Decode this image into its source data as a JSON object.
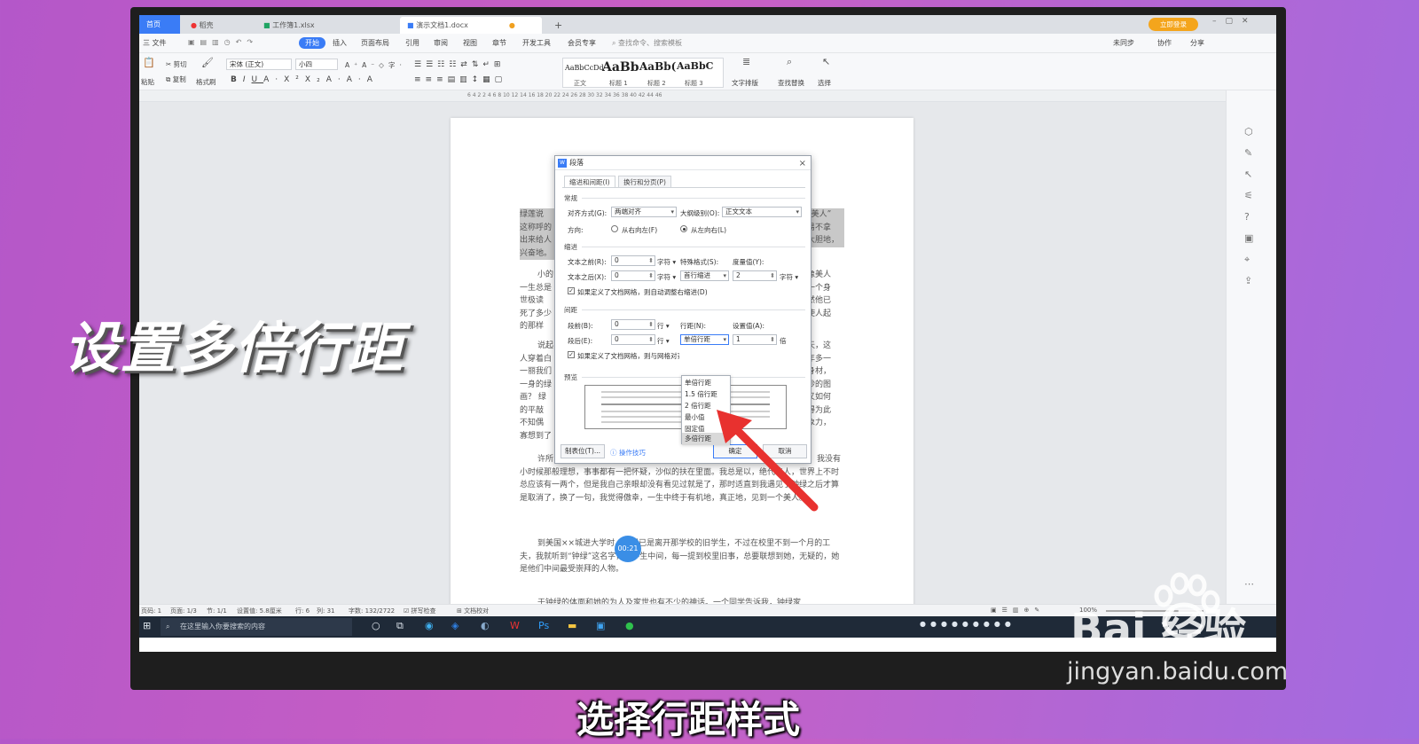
{
  "tabs": {
    "home": "首页",
    "t1": "稻壳",
    "t2": "工作簿1.xlsx",
    "t3": "演示文档1.docx",
    "new": "+"
  },
  "tabbar_right": {
    "login": "立即登录"
  },
  "menu": {
    "file": "三 文件",
    "start": "开始",
    "insert": "插入",
    "layout": "页面布局",
    "ref": "引用",
    "review": "审阅",
    "view": "视图",
    "chapter": "章节",
    "dev": "开发工具",
    "member": "会员专享",
    "search": "查找命令、搜索模板",
    "sync": "未同步",
    "collab": "协作",
    "share": "分享"
  },
  "ribbon": {
    "paste": "粘贴",
    "cut": "剪切",
    "copy": "复制",
    "format_painter": "格式刷",
    "font": "宋体 (正文)",
    "size": "小四",
    "styles": [
      {
        "sample": "AaBbCcDd",
        "name": "正文"
      },
      {
        "sample": "AaBb",
        "name": "标题 1"
      },
      {
        "sample": "AaBb(",
        "name": "标题 2"
      },
      {
        "sample": "AaBbC",
        "name": "标题 3"
      }
    ],
    "text_layout": "文字排版",
    "find_replace": "查找替换",
    "select": "选择"
  },
  "ruler": {
    "numbers": "6   4   2       2   4   6   8   10   12   14   16   18   20   22   24   26   28   30   32   34   36   38   40   42   44   46"
  },
  "document": {
    "p1_lines": [
      "绿莲说",
      "这称呼的",
      "出来给人",
      "兴奋地。"
    ],
    "p1_right": [
      "“美人”",
      "易不拿",
      "大胆地，"
    ],
    "p2_lines": [
      "小的",
      "一生总是",
      "世极读",
      "死了多少",
      "的那样"
    ],
    "p2_right": [
      "像美人",
      "一个身",
      "然他已",
      "使人起"
    ],
    "p3_lines": [
      "说起",
      "人穿着白",
      "一丽我们",
      "一身的绿",
      "画？ 绿",
      "的平敲",
      "不知偶",
      "寡想到了"
    ],
    "p3_right": [
      "天，这",
      "年多一",
      "身材，",
      "妙的图",
      "又如何",
      "得为此",
      "象力，"
    ],
    "p4": "许所以这个亲底美人之为美人，也从来留在我心里被问过，过了一些，积极地，我没有小时候那般理想，事事都有一把怀疑，沙似的扶在里面。我总是以，绝代佳人，世界上不时总应该有一两个，但是我自己亲眼却没有看见过就是了，那时适直到我遇见了钟绿之后才算是取消了，换了一句，我觉得傲幸，一生中终于有机地，真正地，见到一个美人。",
    "p5": "到美国××城进大学时，钟绿已是离开那学校的旧学生，不过在校里不到一个月的工夫，我就听到“钟绿”这名字，在学生中间，每一提到校里旧事，总要联想到她，无疑的，她是他们中间最受崇拜的人物。",
    "p6": "于钟绿的体面和她的为人及家世也有不少的神话。一个同学告诉我，钟绿家"
  },
  "dialog": {
    "title": "段落",
    "close": "×",
    "tab1": "缩进和间距(I)",
    "tab2": "换行和分页(P)",
    "general": "常规",
    "align_label": "对齐方式(G):",
    "align_value": "两端对齐",
    "outline_label": "大纲级别(O):",
    "outline_value": "正文文本",
    "direction_label": "方向:",
    "dir_rtl": "从右向左(F)",
    "dir_ltr": "从左向右(L)",
    "indent": "缩进",
    "before_text_label": "文本之前(R):",
    "before_text_value": "0",
    "after_text_label": "文本之后(X):",
    "after_text_value": "0",
    "unit_char": "字符 ▾",
    "special_label": "特殊格式(S):",
    "special_value": "首行缩进",
    "measure_label": "度量值(Y):",
    "measure_value": "2",
    "grid_indent": "如果定义了文档网格，则自动调整右缩进(D)",
    "spacing": "间距",
    "before_label": "段前(B):",
    "before_value": "0",
    "after_label": "段后(E):",
    "after_value": "0",
    "unit_line": "行 ▾",
    "line_spacing_label": "行距(N):",
    "line_spacing_value": "单倍行距",
    "setting_label": "设置值(A):",
    "setting_value": "1",
    "unit_times": "倍",
    "grid_snap": "如果定义了文档网格，则与网格对齐(W)",
    "preview": "预览",
    "tabs_btn": "制表位(T)...",
    "tips": "操作技巧",
    "ok": "确定",
    "cancel": "取消"
  },
  "dropdown": {
    "options": [
      "单倍行距",
      "1.5 倍行距",
      "2 倍行距",
      "最小值",
      "固定值",
      "多倍行距"
    ],
    "selected": "多倍行距"
  },
  "statusbar": {
    "page_no": "页码: 1",
    "pages": "页面: 1/3",
    "section": "节: 1/1",
    "setting": "设置值: 5.8厘米",
    "row": "行: 6",
    "col": "列: 31",
    "words": "字数: 132/2722",
    "spell": "拼写检查",
    "proof": "文档校对",
    "zoom": "100%"
  },
  "taskbar": {
    "search": "在这里输入你要搜索的内容"
  },
  "video_overlay": {
    "title": "设置多倍行距",
    "subtitle": "选择行距样式",
    "timer": "00:21"
  },
  "watermark": {
    "text": "Bai 经验",
    "url": "jingyan.baidu.com"
  },
  "colors": {
    "accent": "#3a7cf6",
    "arrow": "#e8312f",
    "background": "#c95fc3"
  }
}
